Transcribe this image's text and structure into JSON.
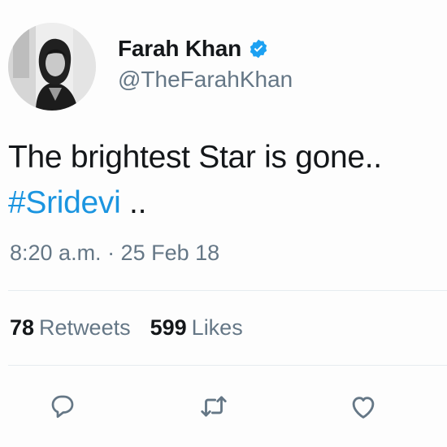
{
  "user": {
    "display_name": "Farah Khan",
    "handle": "@TheFarahKhan",
    "verified": true,
    "avatar_icon": "profile-photo"
  },
  "tweet": {
    "text_line1": "The brightest Star is gone..",
    "hashtag": "#Sridevi",
    "text_after_hashtag": " ..",
    "timestamp": "8:20 a.m. · 25 Feb 18"
  },
  "stats": {
    "retweets_count": "78",
    "retweets_label": "Retweets",
    "likes_count": "599",
    "likes_label": "Likes"
  },
  "actions": {
    "reply_icon": "reply-icon",
    "retweet_icon": "retweet-icon",
    "like_icon": "heart-icon"
  },
  "colors": {
    "text": "#14171a",
    "secondary": "#657786",
    "link": "#1b95e0",
    "verified": "#1da1f2",
    "divider": "#e6ecf0"
  }
}
